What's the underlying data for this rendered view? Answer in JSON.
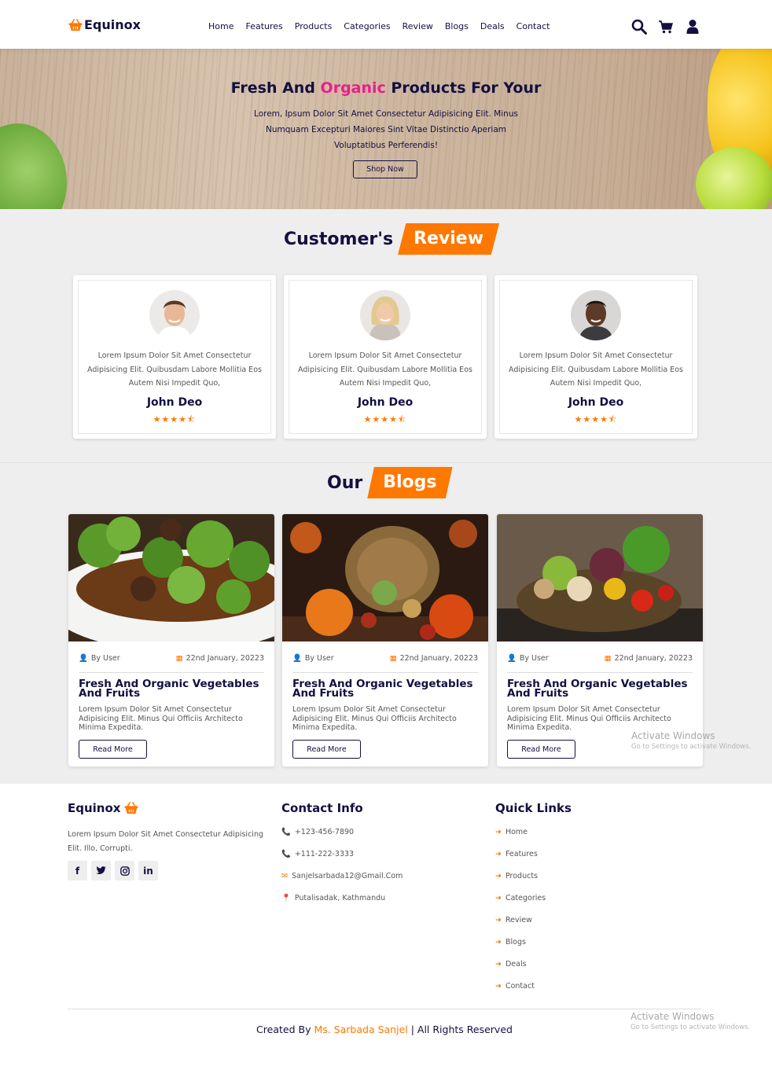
{
  "header": {
    "logo_text": "Equinox",
    "nav": [
      "Home",
      "Features",
      "Products",
      "Categories",
      "Review",
      "Blogs",
      "Deals",
      "Contact"
    ],
    "icons": [
      "search-icon",
      "cart-icon",
      "user-icon"
    ]
  },
  "hero": {
    "title_start": "Fresh And ",
    "title_accent": "Organic",
    "title_end": " Products For Your",
    "text": "Lorem, Ipsum Dolor Sit Amet Consectetur Adipisicing Elit. Minus Numquam Excepturi Maiores Sint Vitae Distinctio Aperiam Voluptatibus Perferendis!",
    "button": "Shop Now"
  },
  "reviews": {
    "heading_start": "Customer's",
    "heading_accent": "Review",
    "items": [
      {
        "text": "Lorem Ipsum Dolor Sit Amet Consectetur Adipisicing Elit. Quibusdam Labore Mollitia Eos Autem Nisi Impedit Quo,",
        "name": "John Deo",
        "rating": 4.5
      },
      {
        "text": "Lorem Ipsum Dolor Sit Amet Consectetur Adipisicing Elit. Quibusdam Labore Mollitia Eos Autem Nisi Impedit Quo,",
        "name": "John Deo",
        "rating": 4.5
      },
      {
        "text": "Lorem Ipsum Dolor Sit Amet Consectetur Adipisicing Elit. Quibusdam Labore Mollitia Eos Autem Nisi Impedit Quo,",
        "name": "John Deo",
        "rating": 4.5
      }
    ]
  },
  "blogs": {
    "heading_start": "Our",
    "heading_accent": "Blogs",
    "items": [
      {
        "author": "By User",
        "date": "22nd January, 20223",
        "title": "Fresh And Organic Vegetables And Fruits",
        "text": "Lorem Ipsum Dolor Sit Amet Consectetur Adipisicing Elit. Minus Qui Officiis Architecto Minima Expedita.",
        "button": "Read More"
      },
      {
        "author": "By User",
        "date": "22nd January, 20223",
        "title": "Fresh And Organic Vegetables And Fruits",
        "text": "Lorem Ipsum Dolor Sit Amet Consectetur Adipisicing Elit. Minus Qui Officiis Architecto Minima Expedita.",
        "button": "Read More"
      },
      {
        "author": "By User",
        "date": "22nd January, 20223",
        "title": "Fresh And Organic Vegetables And Fruits",
        "text": "Lorem Ipsum Dolor Sit Amet Consectetur Adipisicing Elit. Minus Qui Officiis Architecto Minima Expedita.",
        "button": "Read More"
      }
    ]
  },
  "footer": {
    "brand": "Equinox",
    "about": "Lorem Ipsum Dolor Sit Amet Consectetur Adipisicing Elit. Illo, Corrupti.",
    "socials": [
      "facebook-icon",
      "twitter-icon",
      "instagram-icon",
      "linkedin-icon"
    ],
    "contact_title": "Contact Info",
    "contacts": [
      "+123-456-7890",
      "+111-222-3333",
      "Sanjelsarbada12@Gmail.Com",
      "Putalisadak, Kathmandu"
    ],
    "links_title": "Quick Links",
    "links": [
      "Home",
      "Features",
      "Products",
      "Categories",
      "Review",
      "Blogs",
      "Deals",
      "Contact"
    ],
    "credit_start": "Created By ",
    "credit_name": "Ms. Sarbada Sanjel",
    "credit_end": " | All Rights Reserved"
  },
  "watermark": {
    "title": "Activate Windows",
    "subtitle": "Go to Settings to activate Windows."
  },
  "colors": {
    "accent": "#ff7800",
    "dark": "#130f40",
    "pink": "#e91e8c",
    "section_bg": "#eeeeee"
  }
}
